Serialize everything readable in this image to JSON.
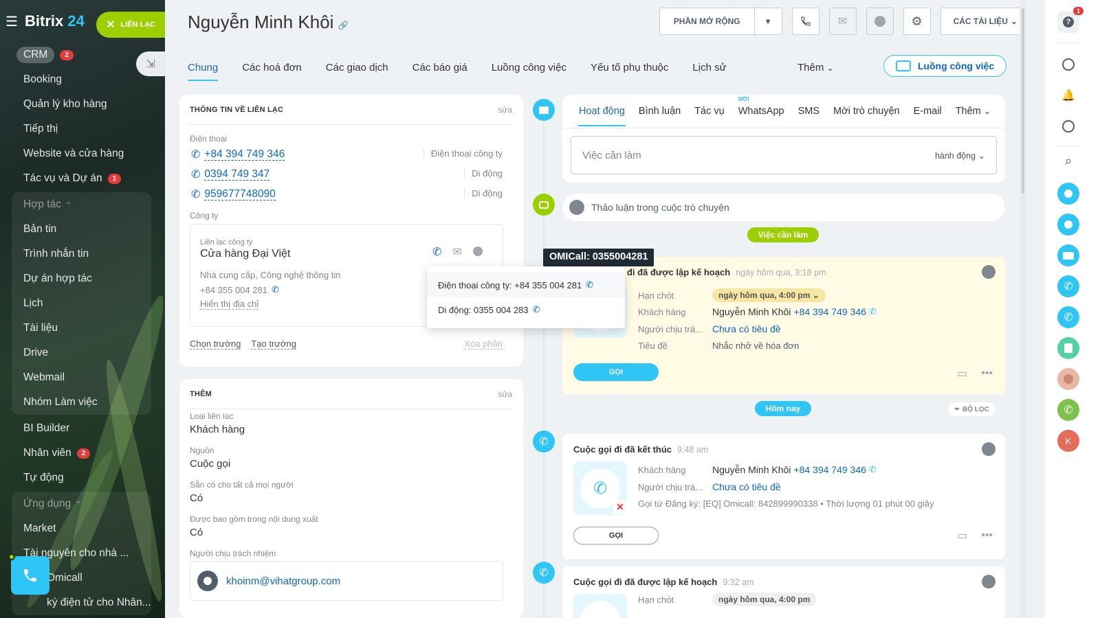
{
  "sidebar": {
    "brand_text": "Bitrix",
    "brand_num": "24",
    "contact_button": "LIÊN LẠC",
    "items": [
      {
        "label": "CRM",
        "badge": "2"
      },
      {
        "label": "Booking",
        "badge": ""
      },
      {
        "label": "Quản lý kho hàng",
        "badge": ""
      },
      {
        "label": "Tiếp thị",
        "badge": ""
      },
      {
        "label": "Website và cửa hàng",
        "badge": ""
      },
      {
        "label": "Tác vụ và Dự án",
        "badge": "1"
      }
    ],
    "collab_group": {
      "header": "Hợp tác",
      "items": [
        "Bản tin",
        "Trình nhắn tin",
        "Dự án hợp tác",
        "Lịch",
        "Tài liệu",
        "Drive",
        "Webmail",
        "Nhóm Làm việc"
      ]
    },
    "items2": [
      {
        "label": "BI Builder",
        "badge": ""
      },
      {
        "label": "Nhân viên",
        "badge": "2"
      },
      {
        "label": "Tự động",
        "badge": ""
      }
    ],
    "apps_group": {
      "header": "Ứng dụng",
      "items": [
        "Market",
        "Tài nguyên cho nhà ...",
        "Omicall",
        "ký điện tử cho Nhân..."
      ]
    }
  },
  "header": {
    "title": "Nguyễn Minh Khôi",
    "extend_button": "PHẦN MỞ RỘNG",
    "documents_button": "CÁC TÀI LIỆU"
  },
  "tabs": {
    "items": [
      "Chung",
      "Các hoá đơn",
      "Các giao dịch",
      "Các báo giá",
      "Luồng công việc",
      "Yếu tố phụ thuộc",
      "Lịch sử"
    ],
    "more": "Thêm",
    "flow_button": "Luồng công việc"
  },
  "contact_card": {
    "header": "THÔNG TIN VỀ LIÊN LẠC",
    "edit": "sửa",
    "phone_label": "Điện thoại",
    "phones": [
      {
        "number": "+84 394 749 346",
        "type": "Điện thoại công ty"
      },
      {
        "number": "0394 749 347",
        "type": "Di động"
      },
      {
        "number": "959677748090",
        "type": "Di động"
      }
    ],
    "company_label": "Công ty",
    "company": {
      "sub": "Liên lạc công ty",
      "name": "Cửa hàng Đại Việt",
      "desc": "Nhà cung cấp, Công nghệ thông tin",
      "phone": "+84 355 004 281",
      "show_address": "Hiển thị địa chỉ"
    },
    "select_field": "Chọn trường",
    "create_field": "Tạo trường",
    "delete_section": "Xóa phần"
  },
  "more_card": {
    "header": "THÊM",
    "edit": "sửa",
    "fields": [
      {
        "label": "Loại liên lạc",
        "value": "Khách hàng"
      },
      {
        "label": "Nguồn",
        "value": "Cuộc gọi"
      },
      {
        "label": "Sẵn có cho tất cả mọi người",
        "value": "Có"
      },
      {
        "label": "Được bao gồm trong nội dung xuất",
        "value": "Có"
      }
    ],
    "responsible_label": "Người chịu trách nhiệm",
    "responsible_email": "khoinm@vihatgroup.com"
  },
  "popup": {
    "tooltip": "OMICall: 0355004281",
    "items": [
      "Điện thoại công ty: +84 355 004 281",
      "Di động: 0355 004 283"
    ]
  },
  "composer": {
    "tabs": [
      "Hoạt động",
      "Bình luận",
      "Tác vụ",
      "WhatsApp",
      "SMS",
      "Mời trò chuyện",
      "E-mail",
      "Thêm"
    ],
    "new_badge": "MỚI",
    "placeholder": "Việc cần làm",
    "action": "hành động"
  },
  "chat_bar": "Thảo luận trong cuộc trò chuyện",
  "timeline": {
    "todo_label": "Việc cần làm",
    "today_label": "Hôm nay",
    "filter_label": "BỘ LỌC",
    "call_planned": {
      "title": "đi đã được lập kế hoạch",
      "time": "ngày hôm qua, 3:18 pm",
      "deadline_key": "Hạn chót",
      "deadline_val": "ngày hôm qua, 4:00 pm",
      "client_key": "Khách hàng",
      "client_name": "Nguyễn Minh Khôi",
      "client_phone": "+84 394 749 346",
      "resp_key": "Người chịu trá...",
      "resp_val": "Chưa có tiêu đề",
      "subject_key": "Tiêu đề",
      "subject_val": "Nhắc nhở về hóa đơn",
      "button": "GỌI"
    },
    "call_done": {
      "title": "Cuộc gọi đi đã kết thúc",
      "time": "9:48 am",
      "client_key": "Khách hàng",
      "client_name": "Nguyễn Minh Khôi",
      "client_phone": "+84 394 749 346",
      "resp_key": "Người chịu trá...",
      "resp_val": "Chưa có tiêu đề",
      "desc": "Gọi từ Đăng ký: [EQ] Omicall: 842899990338 • Thời lượng 01 phút 00 giây",
      "button": "GỌI"
    },
    "call_planned2": {
      "title": "Cuộc gọi đi đã được lập kế hoạch",
      "time": "9:32 am",
      "deadline_key": "Hạn chót",
      "deadline_val": "ngày hôm qua, 4:00 pm"
    }
  },
  "rail": {
    "help_count": "1",
    "avatar_letter": "K"
  },
  "colors": {
    "accent": "#2fc6f6",
    "link": "#0b66c3",
    "green": "#9dcf00",
    "badge": "#e53b3b"
  }
}
